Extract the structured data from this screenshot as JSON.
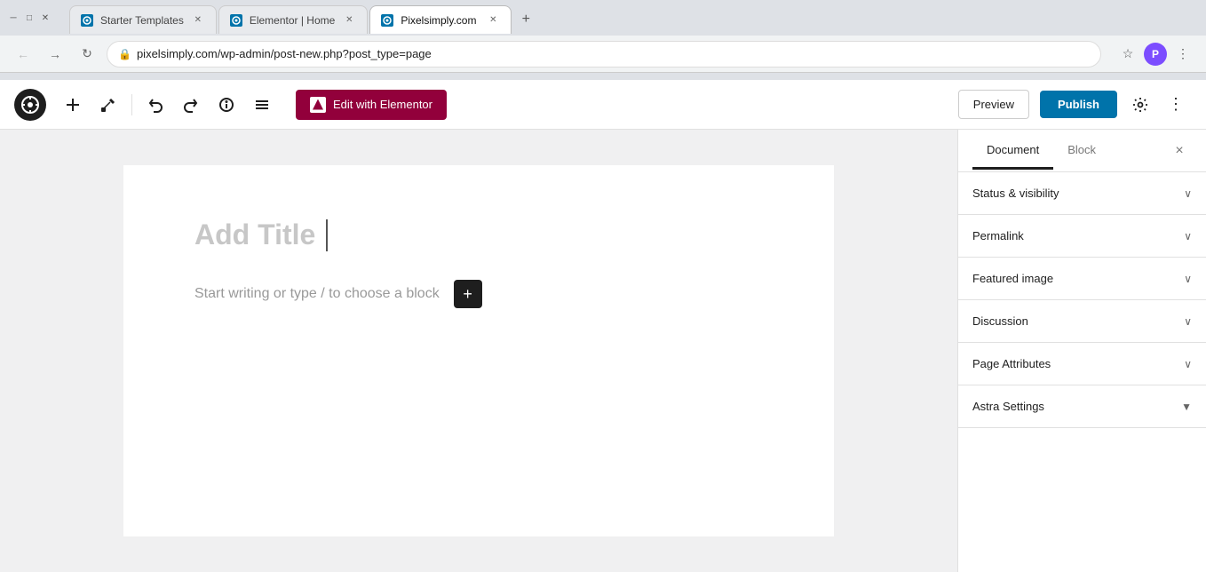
{
  "browser": {
    "tabs": [
      {
        "id": "tab1",
        "title": "Starter Templates",
        "favicon": "wp",
        "active": false,
        "closable": true
      },
      {
        "id": "tab2",
        "title": "Elementor | Home",
        "favicon": "wp",
        "active": false,
        "closable": true
      },
      {
        "id": "tab3",
        "title": "Pixelsimply.com",
        "favicon": "wp",
        "active": true,
        "closable": true
      }
    ],
    "new_tab_label": "+",
    "address": "pixelsimply.com/wp-admin/post-new.php?post_type=page",
    "lock_icon": "🔒"
  },
  "toolbar": {
    "wp_logo": "W",
    "add_block_label": "+",
    "tools_icon": "✏",
    "undo_icon": "↩",
    "redo_icon": "↪",
    "info_icon": "ⓘ",
    "list_icon": "≡",
    "elementor_label": "Edit with Elementor",
    "preview_label": "Preview",
    "publish_label": "Publish",
    "settings_icon": "⚙",
    "more_icon": "⋮"
  },
  "editor": {
    "title_placeholder": "Add Title",
    "block_placeholder": "Start writing or type / to choose a block",
    "add_icon": "+"
  },
  "sidebar": {
    "document_tab": "Document",
    "block_tab": "Block",
    "close_icon": "×",
    "sections": [
      {
        "id": "status",
        "label": "Status & visibility",
        "chevron": "∨"
      },
      {
        "id": "permalink",
        "label": "Permalink",
        "chevron": "∨"
      },
      {
        "id": "featured_image",
        "label": "Featured image",
        "chevron": "∨"
      },
      {
        "id": "discussion",
        "label": "Discussion",
        "chevron": "∨"
      },
      {
        "id": "page_attributes",
        "label": "Page Attributes",
        "chevron": "∨"
      },
      {
        "id": "astra_settings",
        "label": "Astra Settings",
        "chevron": "▼"
      }
    ]
  },
  "colors": {
    "accent_blue": "#0073aa",
    "elementor_red": "#92003b",
    "active_tab_underline": "#1e1e1e"
  }
}
